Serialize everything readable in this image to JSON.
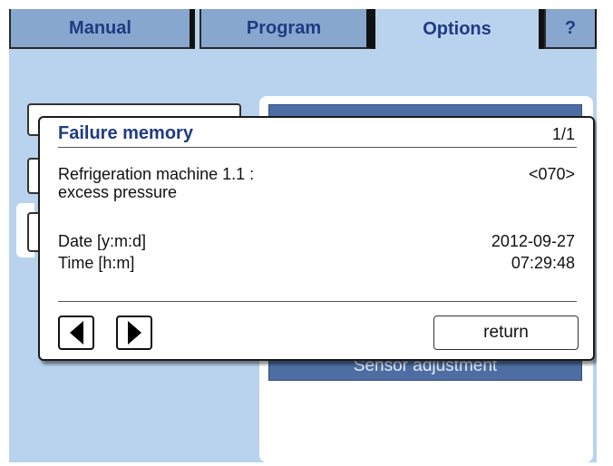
{
  "tabs": {
    "manual": "Manual",
    "program": "Program",
    "options": "Options",
    "help": "?"
  },
  "background": {
    "sensor_button": "Sensor adjustment"
  },
  "dialog": {
    "title": "Failure memory",
    "page": "1/1",
    "failure_line1": "Refrigeration machine 1.1 :",
    "failure_line2": "excess pressure",
    "failure_code": "<070>",
    "date_label": "Date [y:m:d]",
    "date_value": "2012-09-27",
    "time_label": "Time [h:m]",
    "time_value": "07:29:48",
    "return_label": "return"
  },
  "colors": {
    "screen_bg": "#b9d3ee",
    "tab_inactive": "#87a7cf",
    "title_text": "#1f3b82",
    "panel_button": "#4e6ea3"
  },
  "icons": {
    "prev": "triangle-left-icon",
    "next": "triangle-right-icon"
  }
}
